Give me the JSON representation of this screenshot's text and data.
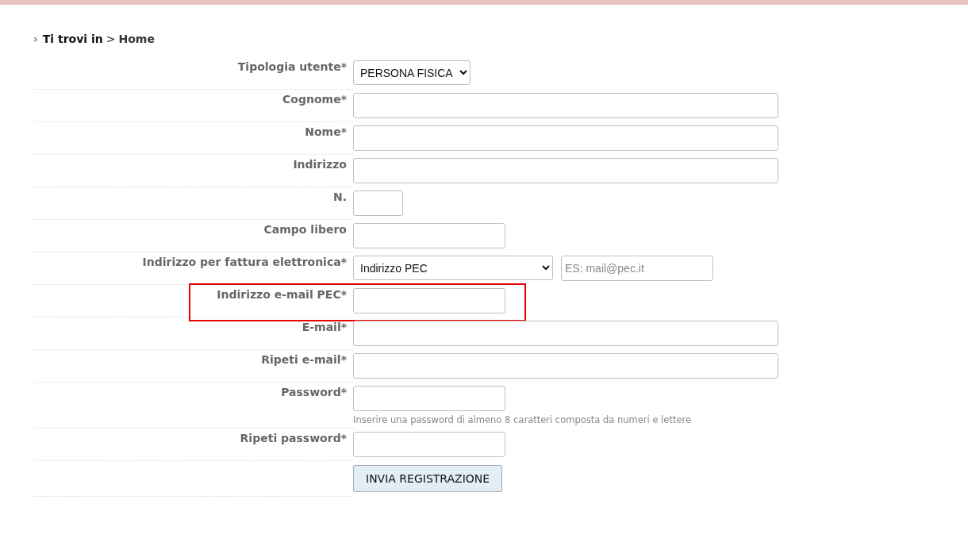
{
  "breadcrumb": {
    "arrow": "›",
    "label": "Ti trovi in",
    "separator": ">",
    "current": "Home"
  },
  "form": {
    "rows": [
      {
        "label": "Tipologia utente*",
        "kind": "select",
        "value": "PERSONA FISICA",
        "highlighted": false
      },
      {
        "label": "Cognome*",
        "kind": "wide-text",
        "highlighted": false
      },
      {
        "label": "Nome*",
        "kind": "wide-text",
        "highlighted": false
      },
      {
        "label": "Indirizzo",
        "kind": "wide-text",
        "highlighted": false
      },
      {
        "label": "N.",
        "kind": "short-text",
        "highlighted": false
      },
      {
        "label": "Campo libero",
        "kind": "medium-text",
        "highlighted": false
      },
      {
        "label": "Indirizzo per fattura elettronica*",
        "kind": "select-input",
        "value": "Indirizzo PEC",
        "placeholder": "ES: mail@pec.it",
        "highlighted": false
      },
      {
        "label": "Indirizzo e-mail PEC*",
        "kind": "medium-text",
        "highlighted": true
      },
      {
        "label": "E-mail*",
        "kind": "wide-text",
        "highlighted": false
      },
      {
        "label": "Ripeti e-mail*",
        "kind": "wide-text",
        "highlighted": false
      },
      {
        "label": "Password*",
        "kind": "medium-text",
        "hint": "Inserire una password di almeno 8 caratteri composta da numeri e lettere",
        "highlighted": false
      },
      {
        "label": "Ripeti password*",
        "kind": "medium-text",
        "highlighted": false
      },
      {
        "label": "",
        "kind": "button",
        "text": "INVIA REGISTRAZIONE",
        "highlighted": false
      }
    ]
  }
}
